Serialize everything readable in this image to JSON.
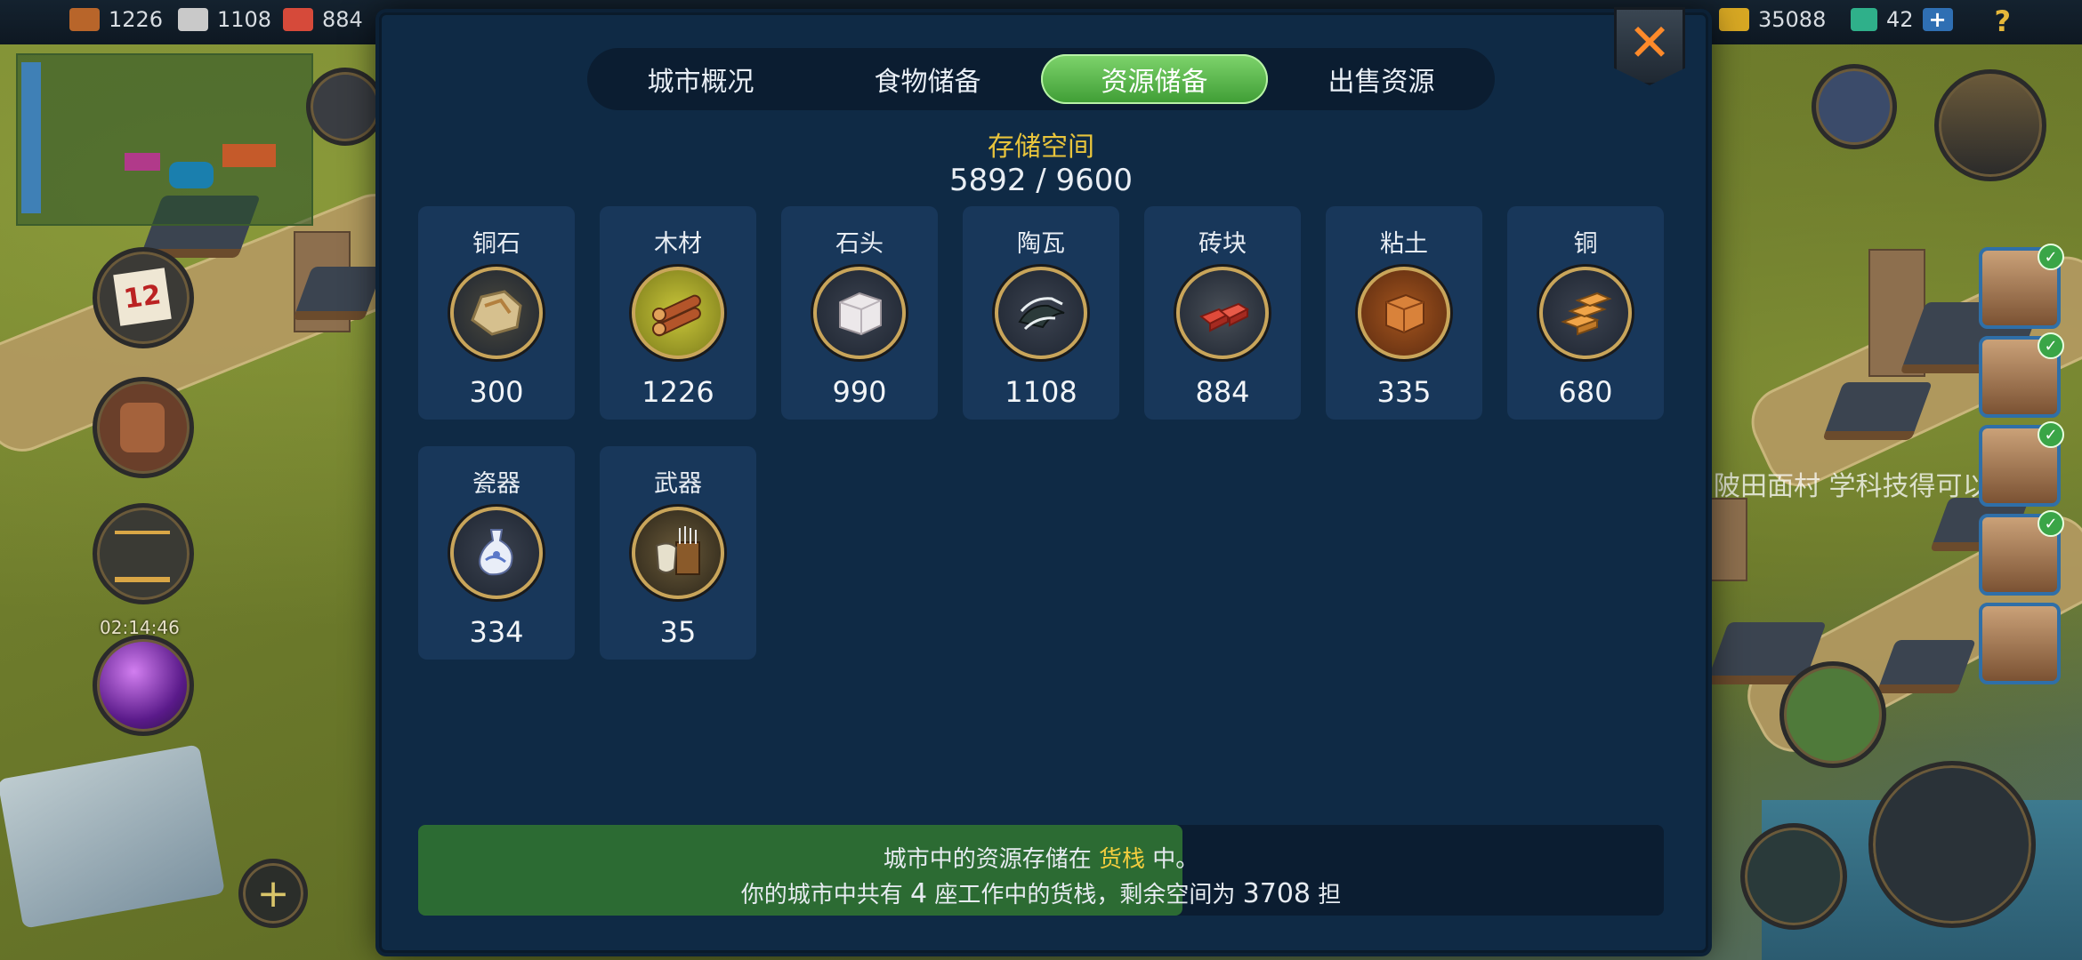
{
  "topbar": {
    "left_resources": [
      {
        "icon": "wood-icon",
        "value": "1226",
        "color": "#b8652a"
      },
      {
        "icon": "tile-icon",
        "value": "1108",
        "color": "#c9c9c9"
      },
      {
        "icon": "brick-icon",
        "value": "884",
        "color": "#d64a3a"
      }
    ],
    "gold": {
      "icon": "gold-ingot-icon",
      "value": "35088",
      "color": "#d8a823"
    },
    "gems": {
      "icon": "jade-icon",
      "value": "42",
      "color": "#2fb08a"
    },
    "add_label": "+",
    "help_label": "?"
  },
  "left_panel": {
    "calendar_day": "12",
    "timer": "02:14:46"
  },
  "background_text": "陂田面村 学科技得可以加好",
  "modal": {
    "close_label": "✕",
    "tabs": [
      {
        "label": "城市概况",
        "active": false
      },
      {
        "label": "食物储备",
        "active": false
      },
      {
        "label": "资源储备",
        "active": true
      },
      {
        "label": "出售资源",
        "active": false
      }
    ],
    "storage_label": "存储空间",
    "storage_value": "5892 / 9600",
    "storage_fraction": 0.6138,
    "resources": [
      {
        "name": "铜石",
        "qty": "300",
        "icon": "copper-ore-icon"
      },
      {
        "name": "木材",
        "qty": "1226",
        "icon": "timber-icon"
      },
      {
        "name": "石头",
        "qty": "990",
        "icon": "stone-block-icon"
      },
      {
        "name": "陶瓦",
        "qty": "1108",
        "icon": "roof-tile-icon"
      },
      {
        "name": "砖块",
        "qty": "884",
        "icon": "brick-icon"
      },
      {
        "name": "粘土",
        "qty": "335",
        "icon": "clay-icon"
      },
      {
        "name": "铜",
        "qty": "680",
        "icon": "copper-ingot-icon"
      },
      {
        "name": "瓷器",
        "qty": "334",
        "icon": "porcelain-vase-icon"
      },
      {
        "name": "武器",
        "qty": "35",
        "icon": "weapons-icon"
      }
    ],
    "footer": {
      "line1_prefix": "城市中的资源存储在",
      "line1_highlight": "货栈",
      "line1_suffix": "中。",
      "line2_prefix": "你的城市中共有",
      "line2_count": "4",
      "line2_middle": "座工作中的货栈，剩余空间为",
      "line2_space": "3708",
      "line2_unit": "担"
    }
  }
}
